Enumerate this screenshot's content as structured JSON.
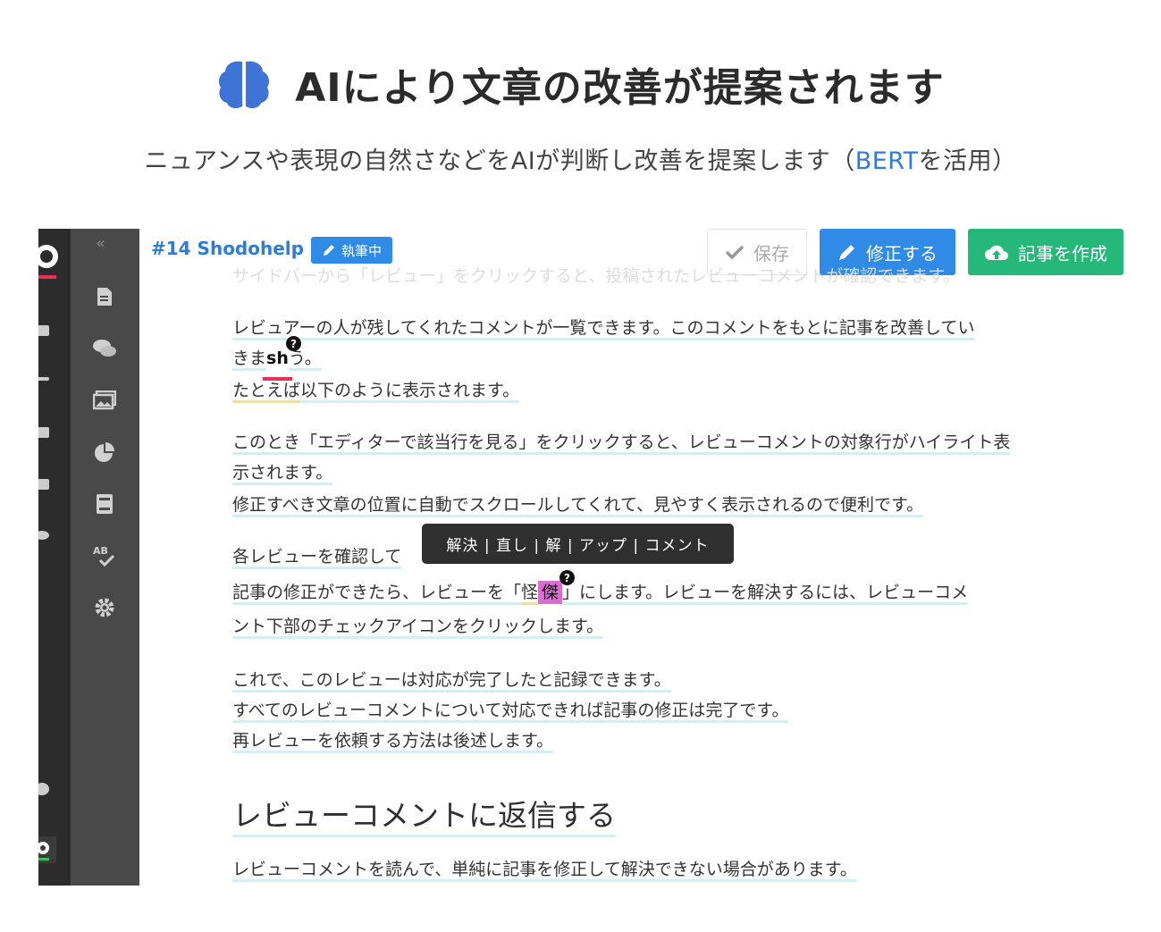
{
  "hero": {
    "icon": "brain-icon",
    "title": "AIにより文章の改善が提案されます",
    "subtitle_before": "ニュアンスや表現の自然さなどをAIが判断し改善を提案します（",
    "subtitle_link": "BERT",
    "subtitle_after": "を活用）",
    "brain_color": "#3f74d6",
    "link_color": "#2f7bd8"
  },
  "app": {
    "sidebar": {
      "collapse_icon": "«",
      "icons": [
        "document-icon",
        "comments-icon",
        "image-icon",
        "pie-chart-icon",
        "book-icon",
        "spellcheck-icon",
        "gear-icon"
      ]
    },
    "header": {
      "doc_id": "#14 Shodohelp",
      "status": "執筆中",
      "save_label": "保存",
      "fix_label": "修正する",
      "create_label": "記事を作成"
    },
    "body": {
      "faded_line": "サイドバーから「レビュー」をクリックすると、投稿されたレビューコメントが確認できます。",
      "p1_line1": "レビュアーの人が残してくれたコメントが一覧できます。このコメントをもとに記事を改善してい",
      "p1_line2_a": "きま",
      "p1_line2_mistake": "sh",
      "p1_line2_b": "う。",
      "p1_line3_a": "たとえば",
      "p1_line3_b": "以下のように表示されます。",
      "p2_line1": "このとき「エディターで該当行を見る」をクリックすると、レビューコメントの対象行がハイライト表",
      "p2_line2": "示されます。",
      "p2_line3": "修正すべき文章の位置に自動でスクロールしてくれて、見やすく表示されるので便利です。",
      "p3_line1_a": "各レビューを確認して",
      "p3_line1_b": "。",
      "p3_line2_a": "記事の修正ができたら、レビューを「",
      "p3_line2_hl1": "怪",
      "p3_line2_hl2": "傑",
      "p3_line2_b": "」にします。レビューを解決するには、レビューコメ",
      "p3_line3": "ント下部のチェックアイコンをクリックします。",
      "p4_line1": "これで、このレビューは対応が完了したと記録できます。",
      "p4_line2": "すべてのレビューコメントについて対応できれば記事の修正は完了です。",
      "p4_line3": "再レビューを依頼する方法は後述します。",
      "heading": "レビューコメントに返信する",
      "p5_line1": "レビューコメントを読んで、単純に記事を修正して解決できない場合があります。",
      "qmark": "?"
    },
    "tooltip": {
      "text": "解決 | 直し | 解 | アップ | コメント"
    }
  }
}
